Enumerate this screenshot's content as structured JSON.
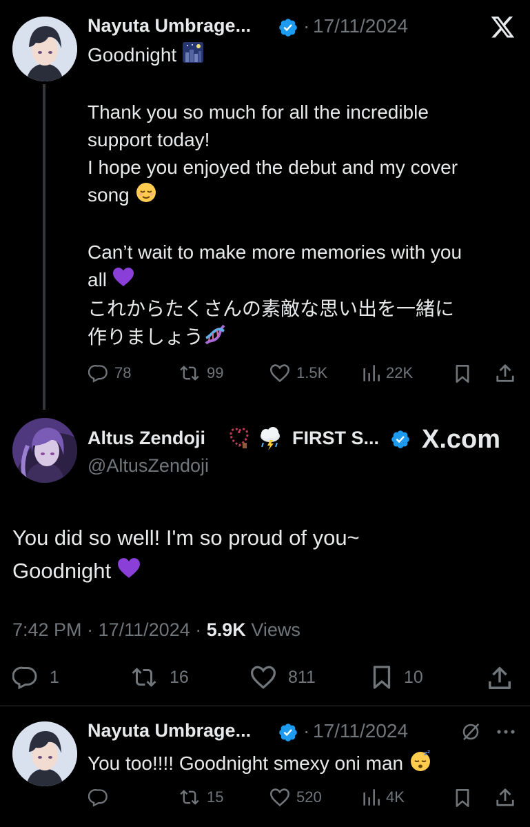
{
  "tweet1": {
    "display_name": "Nayuta Umbrage...",
    "date_sep": "·",
    "date": "17/11/2024",
    "lines": [
      "Goodnight",
      "",
      "Thank you so much for all the incredible",
      "support today!",
      "I hope you enjoyed the debut and my cover",
      "song",
      "",
      "Can’t wait to make more memories with you",
      "all",
      "これからたくさんの素敵な思い出を一緒に",
      "作りましょう"
    ],
    "stats": {
      "replies": "78",
      "reposts": "99",
      "likes": "1.5K",
      "views": "22K"
    }
  },
  "quoted": {
    "display_name": "Altus Zendoji",
    "name_suffix": "FIRST S...",
    "handle": "@AltusZendoji",
    "site_label": "X.com",
    "text_line1": "You did so well! I'm so proud of you~",
    "text_line2": "Goodnight",
    "time": "7:42 PM",
    "date_sep": "·",
    "date": "17/11/2024",
    "views_sep": "·",
    "views_count": "5.9K",
    "views_label": "Views",
    "stats": {
      "replies": "1",
      "reposts": "16",
      "likes": "811",
      "bookmarks": "10"
    }
  },
  "reply": {
    "display_name": "Nayuta Umbrage...",
    "date_sep": "·",
    "date": "17/11/2024",
    "text": "You too!!!! Goodnight smexy oni man",
    "stats": {
      "reposts": "15",
      "likes": "520",
      "views": "4K"
    }
  },
  "colors": {
    "background": "#000000",
    "text": "#e7e9ea",
    "muted": "#71767b",
    "verified": "#1d9bf0",
    "heart_purple": "#8b3fd9"
  }
}
